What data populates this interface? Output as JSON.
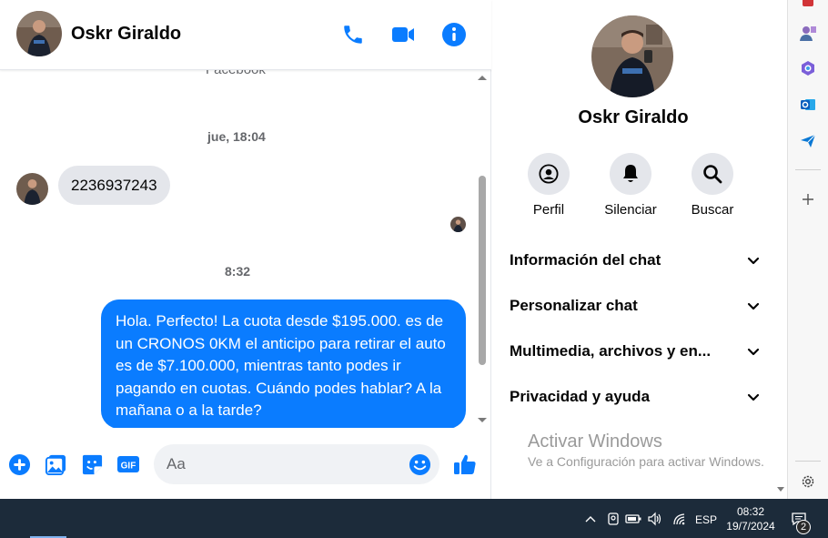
{
  "chat_header": {
    "contact_name": "Oskr Giraldo",
    "icons": [
      "phone-icon",
      "video-camera-icon",
      "info-icon"
    ]
  },
  "messages": {
    "partial_top_text": "Facebook",
    "timestamp_1": "jue, 18:04",
    "incoming_text": "2236937243",
    "timestamp_2": "8:32",
    "outgoing_text": "Hola. Perfecto! La cuota desde $195.000. es de un CRONOS 0KM el anticipo para retirar el auto es de $7.100.000, mientras tanto podes ir pagando en cuotas. Cuándo podes hablar? A la mañana o a la tarde?"
  },
  "composer": {
    "placeholder": "Aa",
    "icons": [
      "add-icon",
      "photo-icon",
      "sticker-icon",
      "gif-icon",
      "emoji-icon",
      "like-icon"
    ]
  },
  "panel": {
    "contact_name": "Oskr Giraldo",
    "actions": [
      {
        "label": "Perfil",
        "icon": "profile-icon"
      },
      {
        "label": "Silenciar",
        "icon": "bell-icon"
      },
      {
        "label": "Buscar",
        "icon": "search-icon"
      }
    ],
    "sections": [
      {
        "label": "Información del chat"
      },
      {
        "label": "Personalizar chat"
      },
      {
        "label": "Multimedia, archivos y en..."
      },
      {
        "label": "Privacidad y ayuda"
      }
    ],
    "watermark_title": "Activar Windows",
    "watermark_subtitle": "Ve a Configuración para activar Windows."
  },
  "taskbar": {
    "language": "ESP",
    "time": "08:32",
    "date": "19/7/2024",
    "notification_count": "2"
  },
  "colors": {
    "accent_blue": "#0a7cff",
    "bubble_gray": "#e4e6eb",
    "text_dark": "#050505",
    "text_muted": "#65676b",
    "taskbar": "#1c2b3a"
  }
}
